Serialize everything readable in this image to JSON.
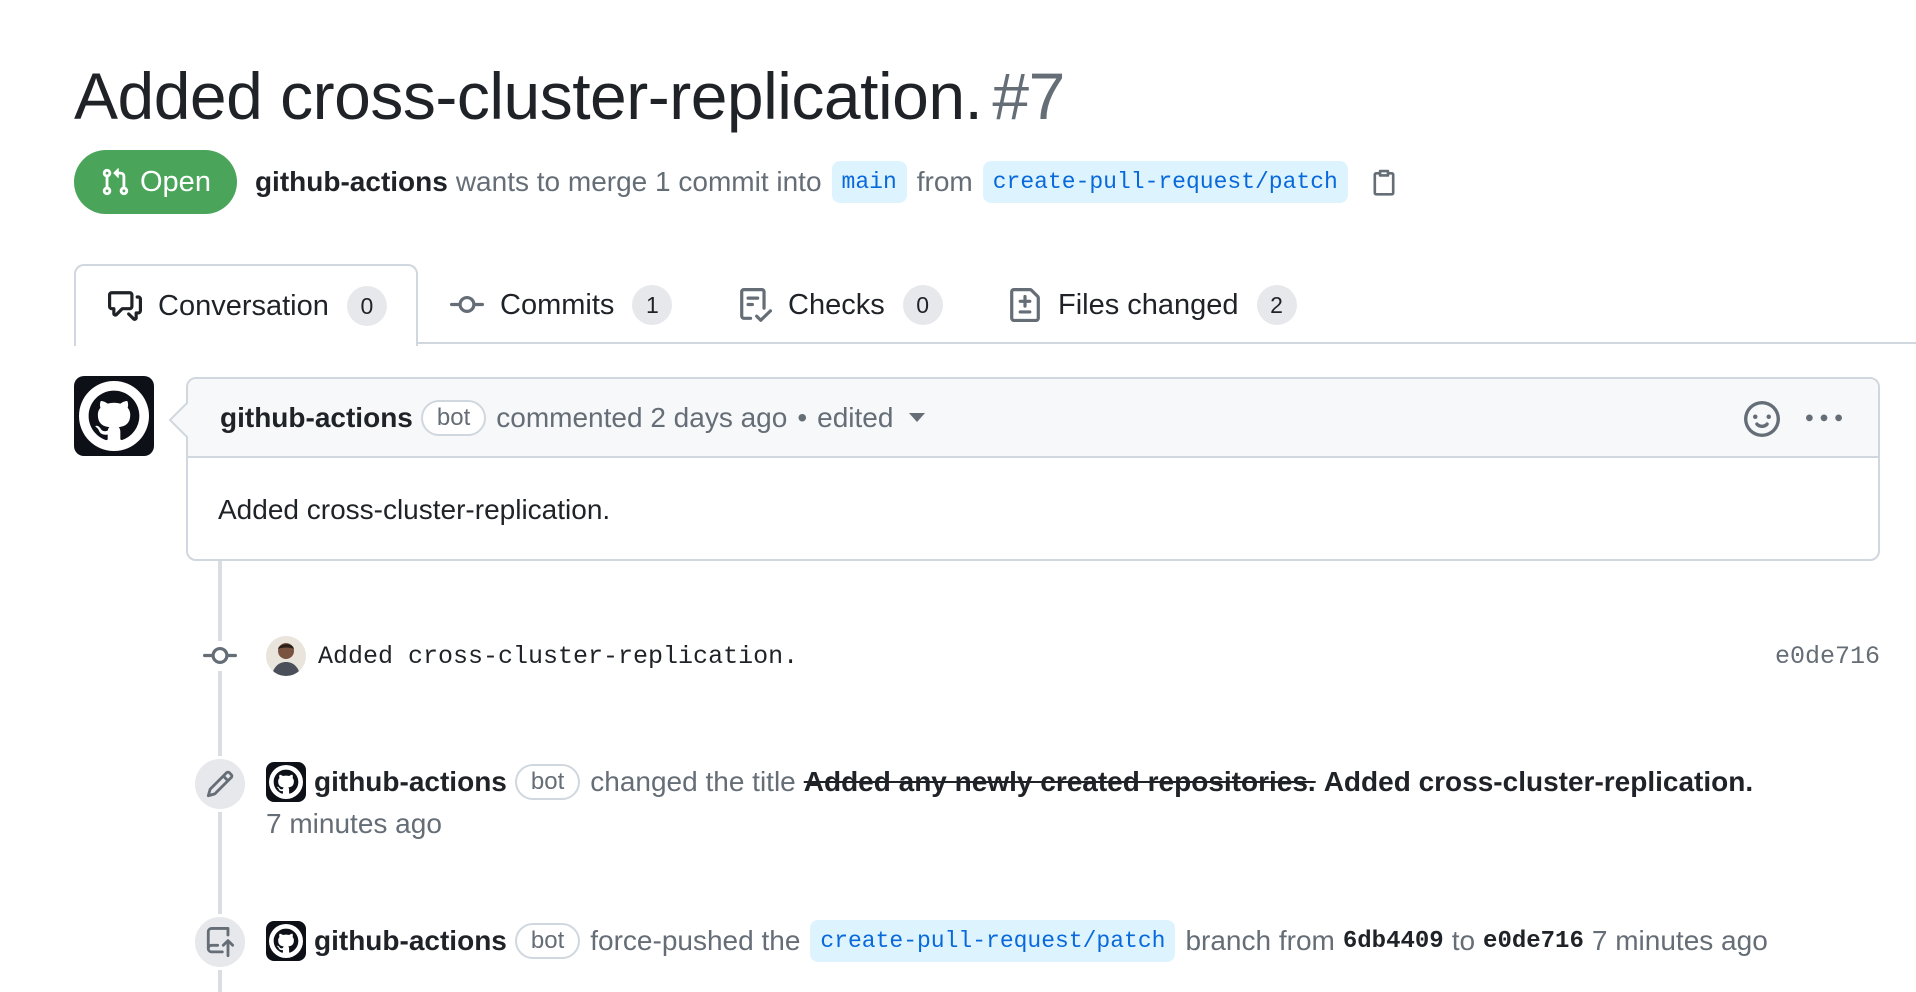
{
  "pr": {
    "title": "Added cross-cluster-replication.",
    "number": "#7",
    "state": "Open",
    "author": "github-actions",
    "merge_text": "wants to merge 1 commit into",
    "base_branch": "main",
    "from_text": "from",
    "head_branch": "create-pull-request/patch"
  },
  "tabs": [
    {
      "label": "Conversation",
      "count": "0"
    },
    {
      "label": "Commits",
      "count": "1"
    },
    {
      "label": "Checks",
      "count": "0"
    },
    {
      "label": "Files changed",
      "count": "2"
    }
  ],
  "comment": {
    "author": "github-actions",
    "bot_label": "bot",
    "action": "commented 2 days ago",
    "separator": "•",
    "edited": "edited",
    "body": "Added cross-cluster-replication."
  },
  "commit": {
    "message": "Added cross-cluster-replication.",
    "sha": "e0de716"
  },
  "title_event": {
    "author": "github-actions",
    "bot_label": "bot",
    "action": "changed the title",
    "old_title": "Added any newly created repositories.",
    "new_title": "Added cross-cluster-replication.",
    "time": "7 minutes ago"
  },
  "push_event": {
    "author": "github-actions",
    "bot_label": "bot",
    "action": "force-pushed the",
    "branch": "create-pull-request/patch",
    "branch_from": "branch from",
    "from_sha": "6db4409",
    "to_text": "to",
    "to_sha": "e0de716",
    "time": "7 minutes ago"
  },
  "colors": {
    "open_green": "#4aa55a",
    "link_blue": "#0969da",
    "branch_bg": "#ddf4ff",
    "muted": "#656d76"
  }
}
